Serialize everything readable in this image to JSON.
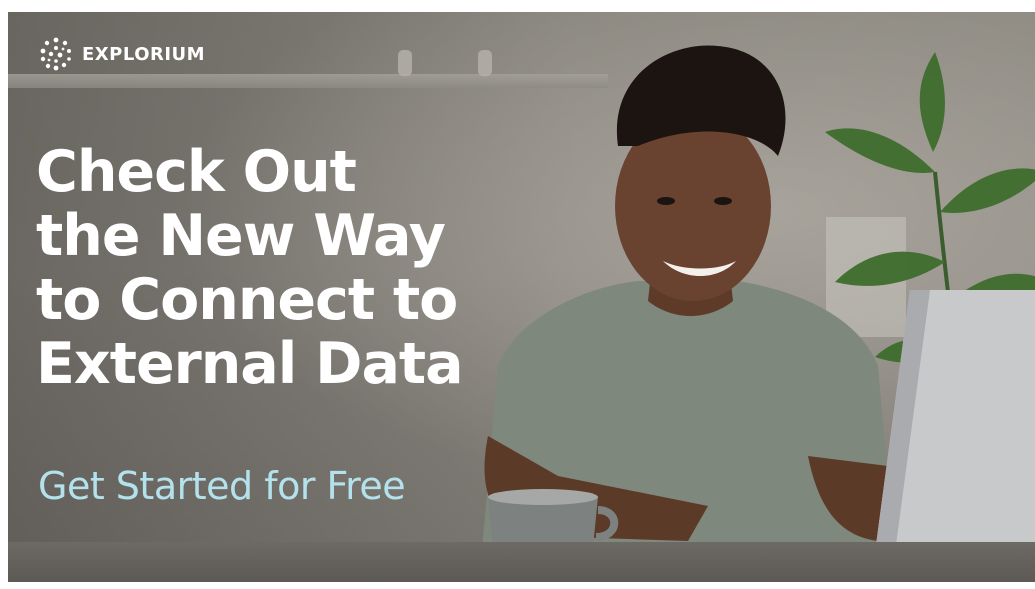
{
  "brand": {
    "name": "EXPLORIUM",
    "icon": "explorium-logo-icon"
  },
  "headline": {
    "lines": [
      "Check Out",
      "the New Way",
      "to Connect to",
      "External Data"
    ]
  },
  "cta": {
    "label": "Get Started for Free",
    "color": "#b4e2ec"
  },
  "colors": {
    "headline": "#ffffff",
    "background": "#8b8880"
  }
}
